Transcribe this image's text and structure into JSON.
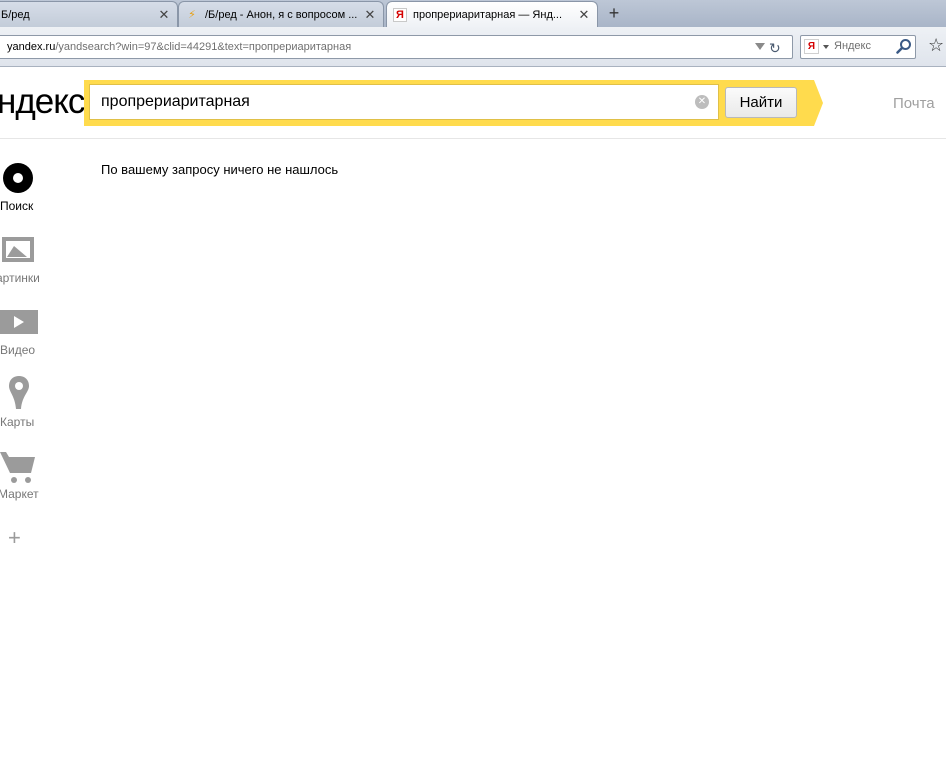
{
  "browser": {
    "tabs": [
      {
        "title": "Б/ред",
        "icon": "page-icon",
        "active": false
      },
      {
        "title": "/Б/ред - Анон, я с вопросом ...",
        "icon": "bolt-icon",
        "active": false
      },
      {
        "title": "пропрериаритарная — Янд...",
        "icon": "yandex-icon",
        "active": true
      }
    ],
    "close_glyph": "✕",
    "new_tab_glyph": "+",
    "url_host": "yandex.ru",
    "url_path": "/yandsearch?win=97&clid=44291&text=пропрериаритарная",
    "search_engine_glyph": "Я",
    "search_engine_name": "Яндекс",
    "favicon_glyph": "Я"
  },
  "page": {
    "logo_text": "ндекс",
    "query": "пропрериаритарная",
    "find_label": "Найти",
    "mail_label": "Почта",
    "result_message": "По вашему запросу ничего не нашлось",
    "clear_glyph": "✕",
    "accent_color": "#ffdb4d"
  },
  "services": [
    {
      "label": "Поиск",
      "icon": "search-circle-icon",
      "active": true
    },
    {
      "label": "Картинки",
      "icon": "images-icon",
      "active": false
    },
    {
      "label": "Видео",
      "icon": "video-icon",
      "active": false
    },
    {
      "label": "Карты",
      "icon": "map-pin-icon",
      "active": false
    },
    {
      "label": "Маркет",
      "icon": "shopping-cart-icon",
      "active": false
    }
  ],
  "more_glyph": "+"
}
